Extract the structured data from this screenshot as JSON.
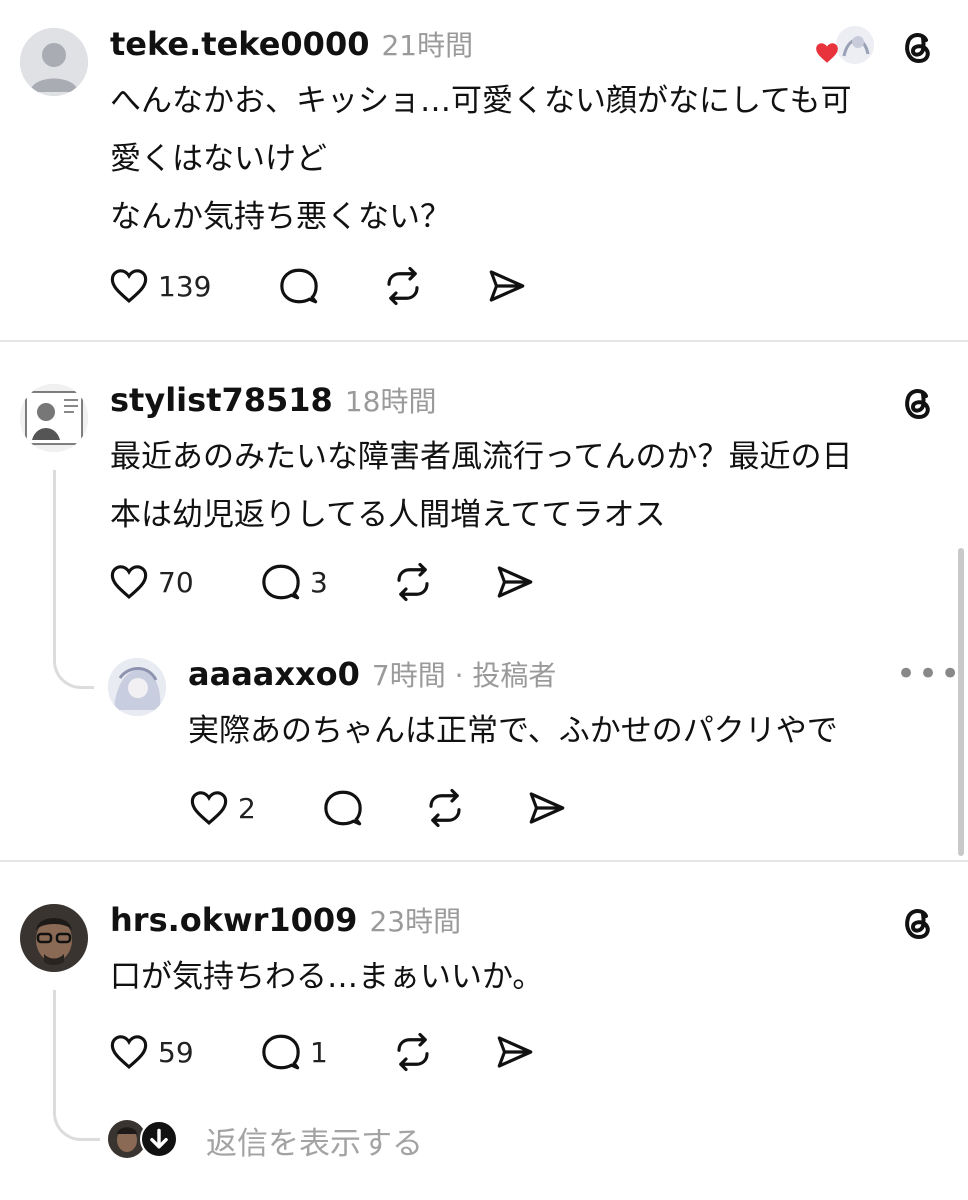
{
  "posts": [
    {
      "username": "teke.teke0000",
      "time": "21時間",
      "text_lines": [
        "へんなかお、キッショ…可愛くない顔がなにしても可",
        "愛くはないけど",
        "なんか気持ち悪くない？"
      ],
      "likes": "139",
      "replies": "",
      "liked_by_icon": "heart-icon"
    },
    {
      "username": "stylist78518",
      "time": "18時間",
      "text_lines": [
        "最近あのみたいな障害者風流行ってんのか？最近の日",
        "本は幼児返りしてる人間増えててラオス"
      ],
      "likes": "70",
      "replies": "3"
    },
    {
      "username": "aaaaxxo0",
      "time": "7時間 · 投稿者",
      "text_lines": [
        "実際あのちゃんは正常で、ふかせのパクリやで"
      ],
      "likes": "2",
      "replies": ""
    },
    {
      "username": "hrs.okwr1009",
      "time": "23時間",
      "text_lines": [
        "口が気持ちわる…まぁいいか。"
      ],
      "likes": "59",
      "replies": "1"
    }
  ],
  "show_replies_label": "返信を表示する",
  "more_menu": "•••",
  "colors": {
    "accent_heart": "#e8323c",
    "muted": "#9a9a9a",
    "divider": "#e6e6e6"
  }
}
